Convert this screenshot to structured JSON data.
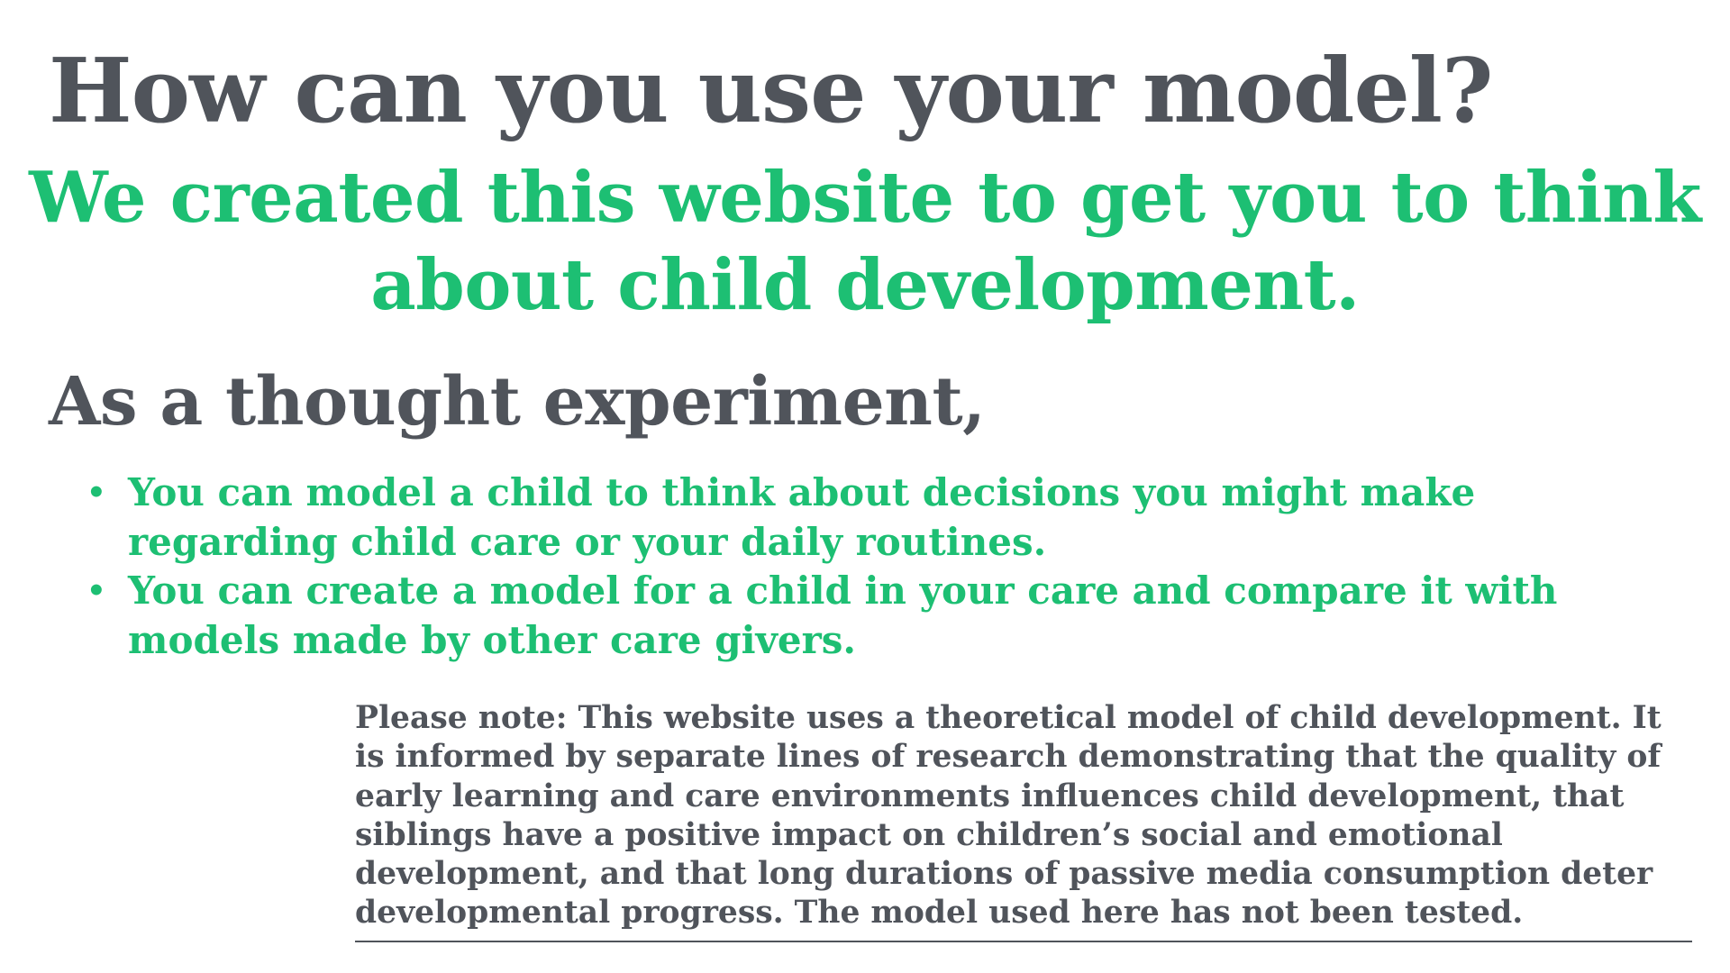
{
  "heading": "How can you use your model?",
  "subheading": "We created this website to get you to think about child development.",
  "section_heading": "As a thought experiment,",
  "bullets": [
    {
      "marker": "•",
      "text": "You can model a child to think about decisions you might make regarding child care or your daily routines."
    },
    {
      "marker": "•",
      "text": "You can create a model for a child in your care and compare it with models made by other care givers."
    }
  ],
  "note": "Please note: This website uses a theoretical model of child development. It is informed by separate lines of research demonstrating that the quality of early learning and care environments influences child development, that siblings have a positive impact on children’s social and emotional development, and that long durations of passive media consumption deter developmental progress. The model used here has not been tested.",
  "colors": {
    "heading": "#50545b",
    "accent": "#1dbf73",
    "background": "#ffffff"
  }
}
